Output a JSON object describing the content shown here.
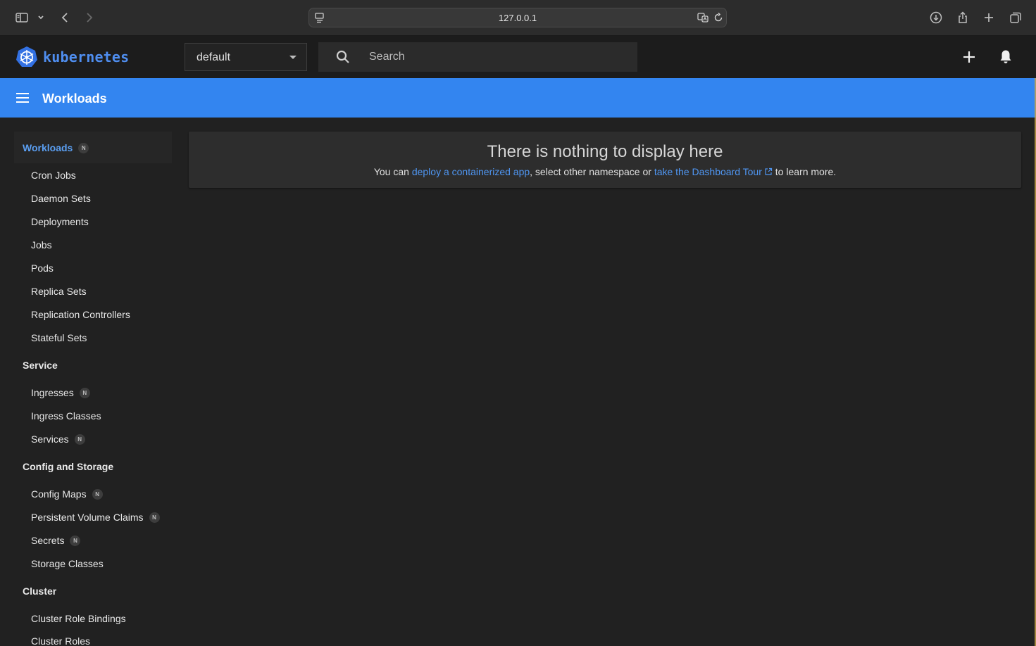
{
  "browser": {
    "url": "127.0.0.1"
  },
  "header": {
    "logo_text": "kubernetes",
    "namespace": "default",
    "search_placeholder": "Search"
  },
  "toolbar": {
    "title": "Workloads"
  },
  "sidebar": {
    "active": {
      "label": "Workloads",
      "badge": "N"
    },
    "workloads": [
      {
        "label": "Cron Jobs"
      },
      {
        "label": "Daemon Sets"
      },
      {
        "label": "Deployments"
      },
      {
        "label": "Jobs"
      },
      {
        "label": "Pods"
      },
      {
        "label": "Replica Sets"
      },
      {
        "label": "Replication Controllers"
      },
      {
        "label": "Stateful Sets"
      }
    ],
    "service_title": "Service",
    "service": [
      {
        "label": "Ingresses",
        "badge": "N"
      },
      {
        "label": "Ingress Classes"
      },
      {
        "label": "Services",
        "badge": "N"
      }
    ],
    "config_title": "Config and Storage",
    "config": [
      {
        "label": "Config Maps",
        "badge": "N"
      },
      {
        "label": "Persistent Volume Claims",
        "badge": "N"
      },
      {
        "label": "Secrets",
        "badge": "N"
      },
      {
        "label": "Storage Classes"
      }
    ],
    "cluster_title": "Cluster",
    "cluster": [
      {
        "label": "Cluster Role Bindings"
      },
      {
        "label": "Cluster Roles"
      }
    ]
  },
  "empty_state": {
    "title": "There is nothing to display here",
    "text_before": "You can ",
    "link_deploy": "deploy a containerized app",
    "text_middle": ", select other namespace or ",
    "link_tour": "take the Dashboard Tour",
    "text_after": " to learn more."
  },
  "colors": {
    "accent": "#3385f0",
    "link": "#4f96f2",
    "background": "#212121"
  }
}
